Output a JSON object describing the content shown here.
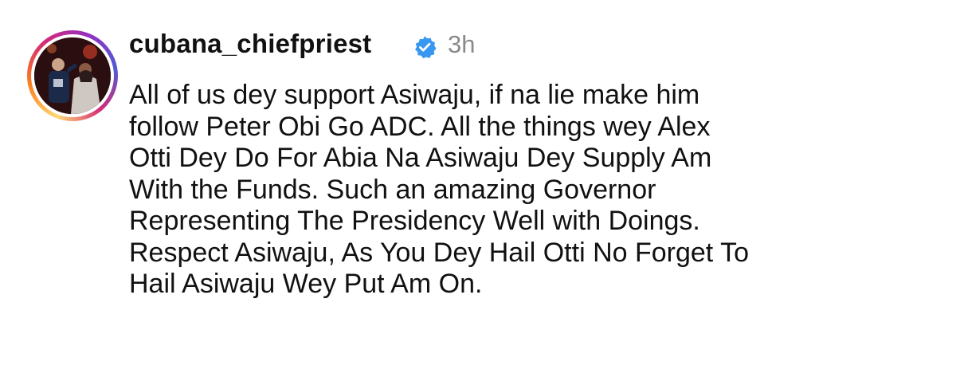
{
  "comment": {
    "username": "cubana_chiefpriest",
    "timestamp": "3h",
    "verified_icon": "verified-badge-icon",
    "accent_color": "#3897f0",
    "lines": [
      "All of us dey support Asiwaju, if na lie make him",
      "follow Peter Obi Go ADC. All the things wey Alex",
      "Otti Dey Do For Abia Na Asiwaju Dey Supply Am",
      "With the Funds. Such an amazing Governor",
      "Representing The Presidency Well with Doings.",
      "Respect Asiwaju, As You Dey Hail Otti No Forget To",
      "Hail Asiwaju Wey Put Am On."
    ]
  }
}
